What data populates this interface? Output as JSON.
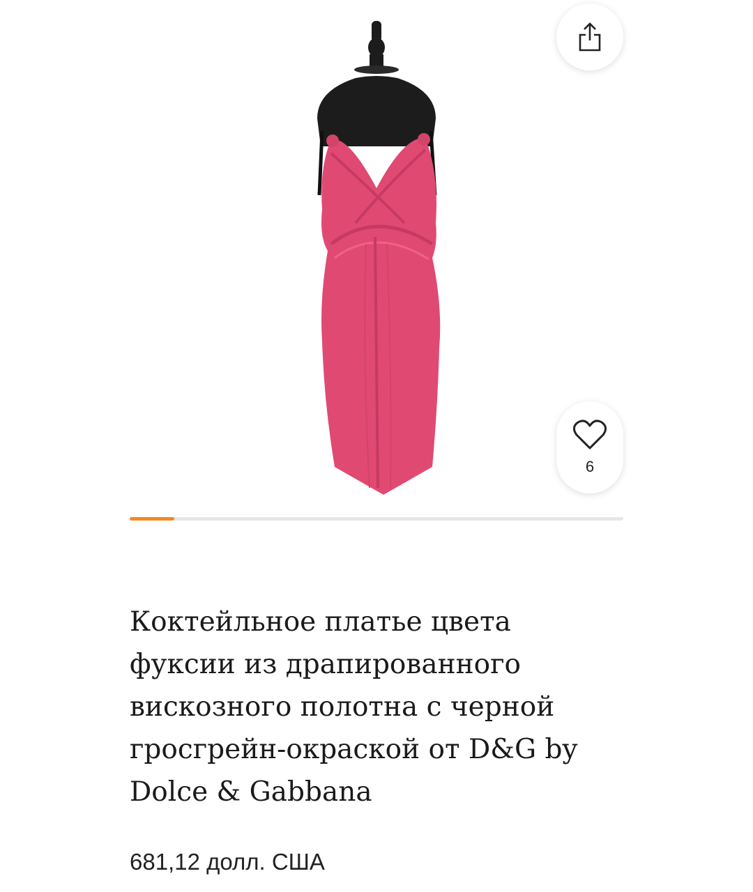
{
  "gallery": {
    "image_alt": "dress-photo",
    "current_index": 1,
    "progress_fraction": 0.09
  },
  "actions": {
    "share_icon": "share-icon",
    "like_icon": "heart-icon",
    "like_count": "6"
  },
  "product": {
    "title": "Коктейльное платье цвета фуксии из драпированного вискозного полотна с черной гросгрейн-окраской от D&G by Dolce & Gabbana",
    "price": "681,12 долл. США"
  },
  "colors": {
    "accent": "#f28a1e",
    "dress": "#e04a72",
    "mannequin": "#1c1c1c"
  }
}
